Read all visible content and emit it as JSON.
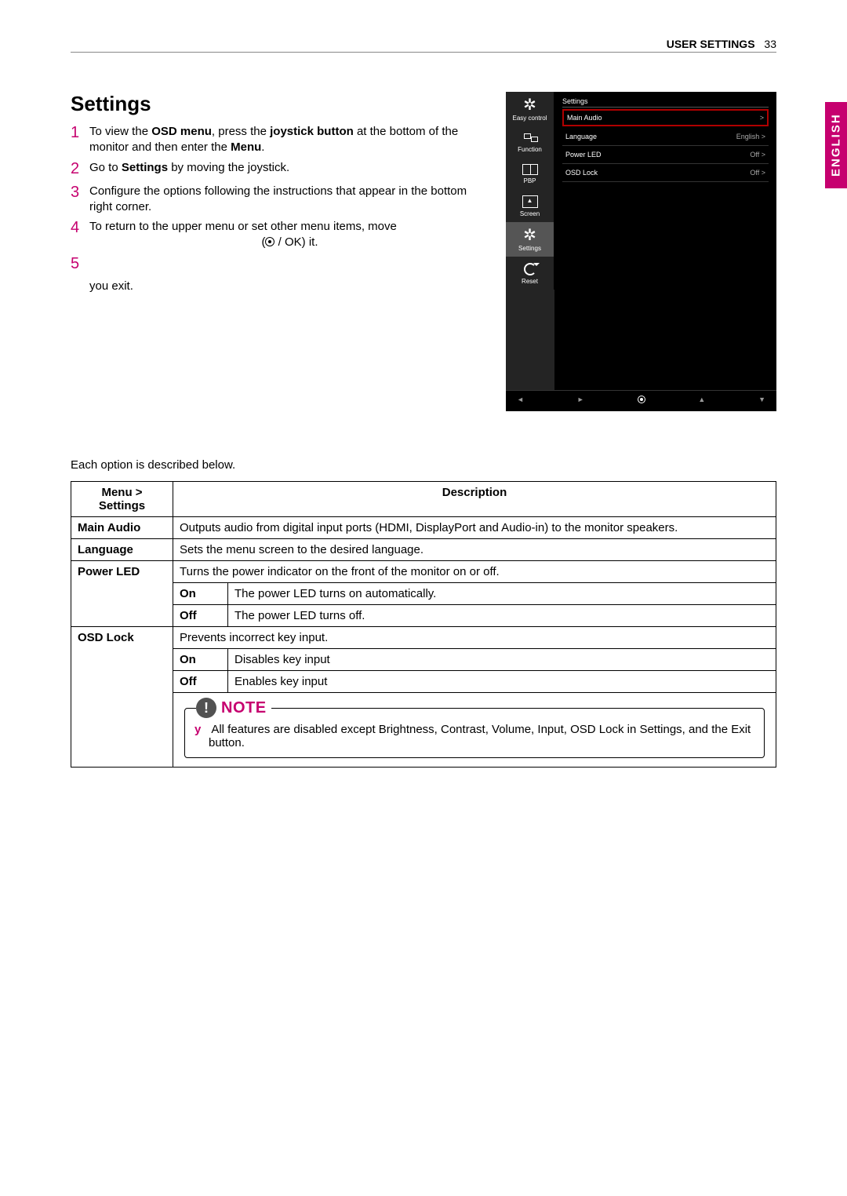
{
  "header": {
    "section": "USER SETTINGS",
    "page": "33"
  },
  "lang_tab": "ENGLISH",
  "heading": "Settings",
  "steps": {
    "s1a": "To view the ",
    "s1b": "OSD menu",
    "s1c": ", press the ",
    "s1d": "joystick button",
    "s1e": " at the bottom of the monitor and then enter the ",
    "s1f": "Menu",
    "s1g": ".",
    "s2a": "Go to ",
    "s2b": "Settings",
    "s2c": " by moving the joystick.",
    "s3": "Configure the options following the instructions that appear in the bottom right corner.",
    "s4a": "To return to the upper menu or set other menu items, move ",
    "s4b": " / OK) it.",
    "s5a": "",
    "s5exit": "you exit."
  },
  "osd": {
    "title": "Settings",
    "side": {
      "easy": "Easy control",
      "func": "Function",
      "pbp": "PBP",
      "screen": "Screen",
      "settings": "Settings",
      "reset": "Reset"
    },
    "rows": {
      "main_audio": {
        "l": "Main Audio",
        "r": ">"
      },
      "language": {
        "l": "Language",
        "r": "English  >"
      },
      "power_led": {
        "l": "Power LED",
        "r": "Off  >"
      },
      "osd_lock": {
        "l": "OSD Lock",
        "r": "Off  >"
      }
    },
    "foot": {
      "a1": "◄",
      "a2": "►",
      "ok": "",
      "a3": "▲",
      "a4": "▼"
    }
  },
  "below_text": "Each option is described below.",
  "table": {
    "h1": "Menu > Settings",
    "h2": "Description",
    "main_audio": {
      "l": "Main Audio",
      "d": "Outputs audio from digital input ports (HDMI, DisplayPort and Audio-in) to the monitor speakers."
    },
    "language": {
      "l": "Language",
      "d": "Sets the menu screen to the desired language."
    },
    "power_led": {
      "l": "Power LED",
      "d": "Turns the power indicator on the front of the monitor on or off.",
      "on": {
        "l": "On",
        "d": "The power LED turns on automatically."
      },
      "off": {
        "l": "Off",
        "d": "The power LED turns off."
      }
    },
    "osd_lock": {
      "l": "OSD Lock",
      "d": "Prevents incorrect key input.",
      "on": {
        "l": "On",
        "d": "Disables key input"
      },
      "off": {
        "l": "Off",
        "d": "Enables key input"
      }
    }
  },
  "note": {
    "title": "NOTE",
    "bullet": "y",
    "text": "All features are disabled except Brightness, Contrast, Volume, Input, OSD Lock in Settings, and the Exit button."
  }
}
